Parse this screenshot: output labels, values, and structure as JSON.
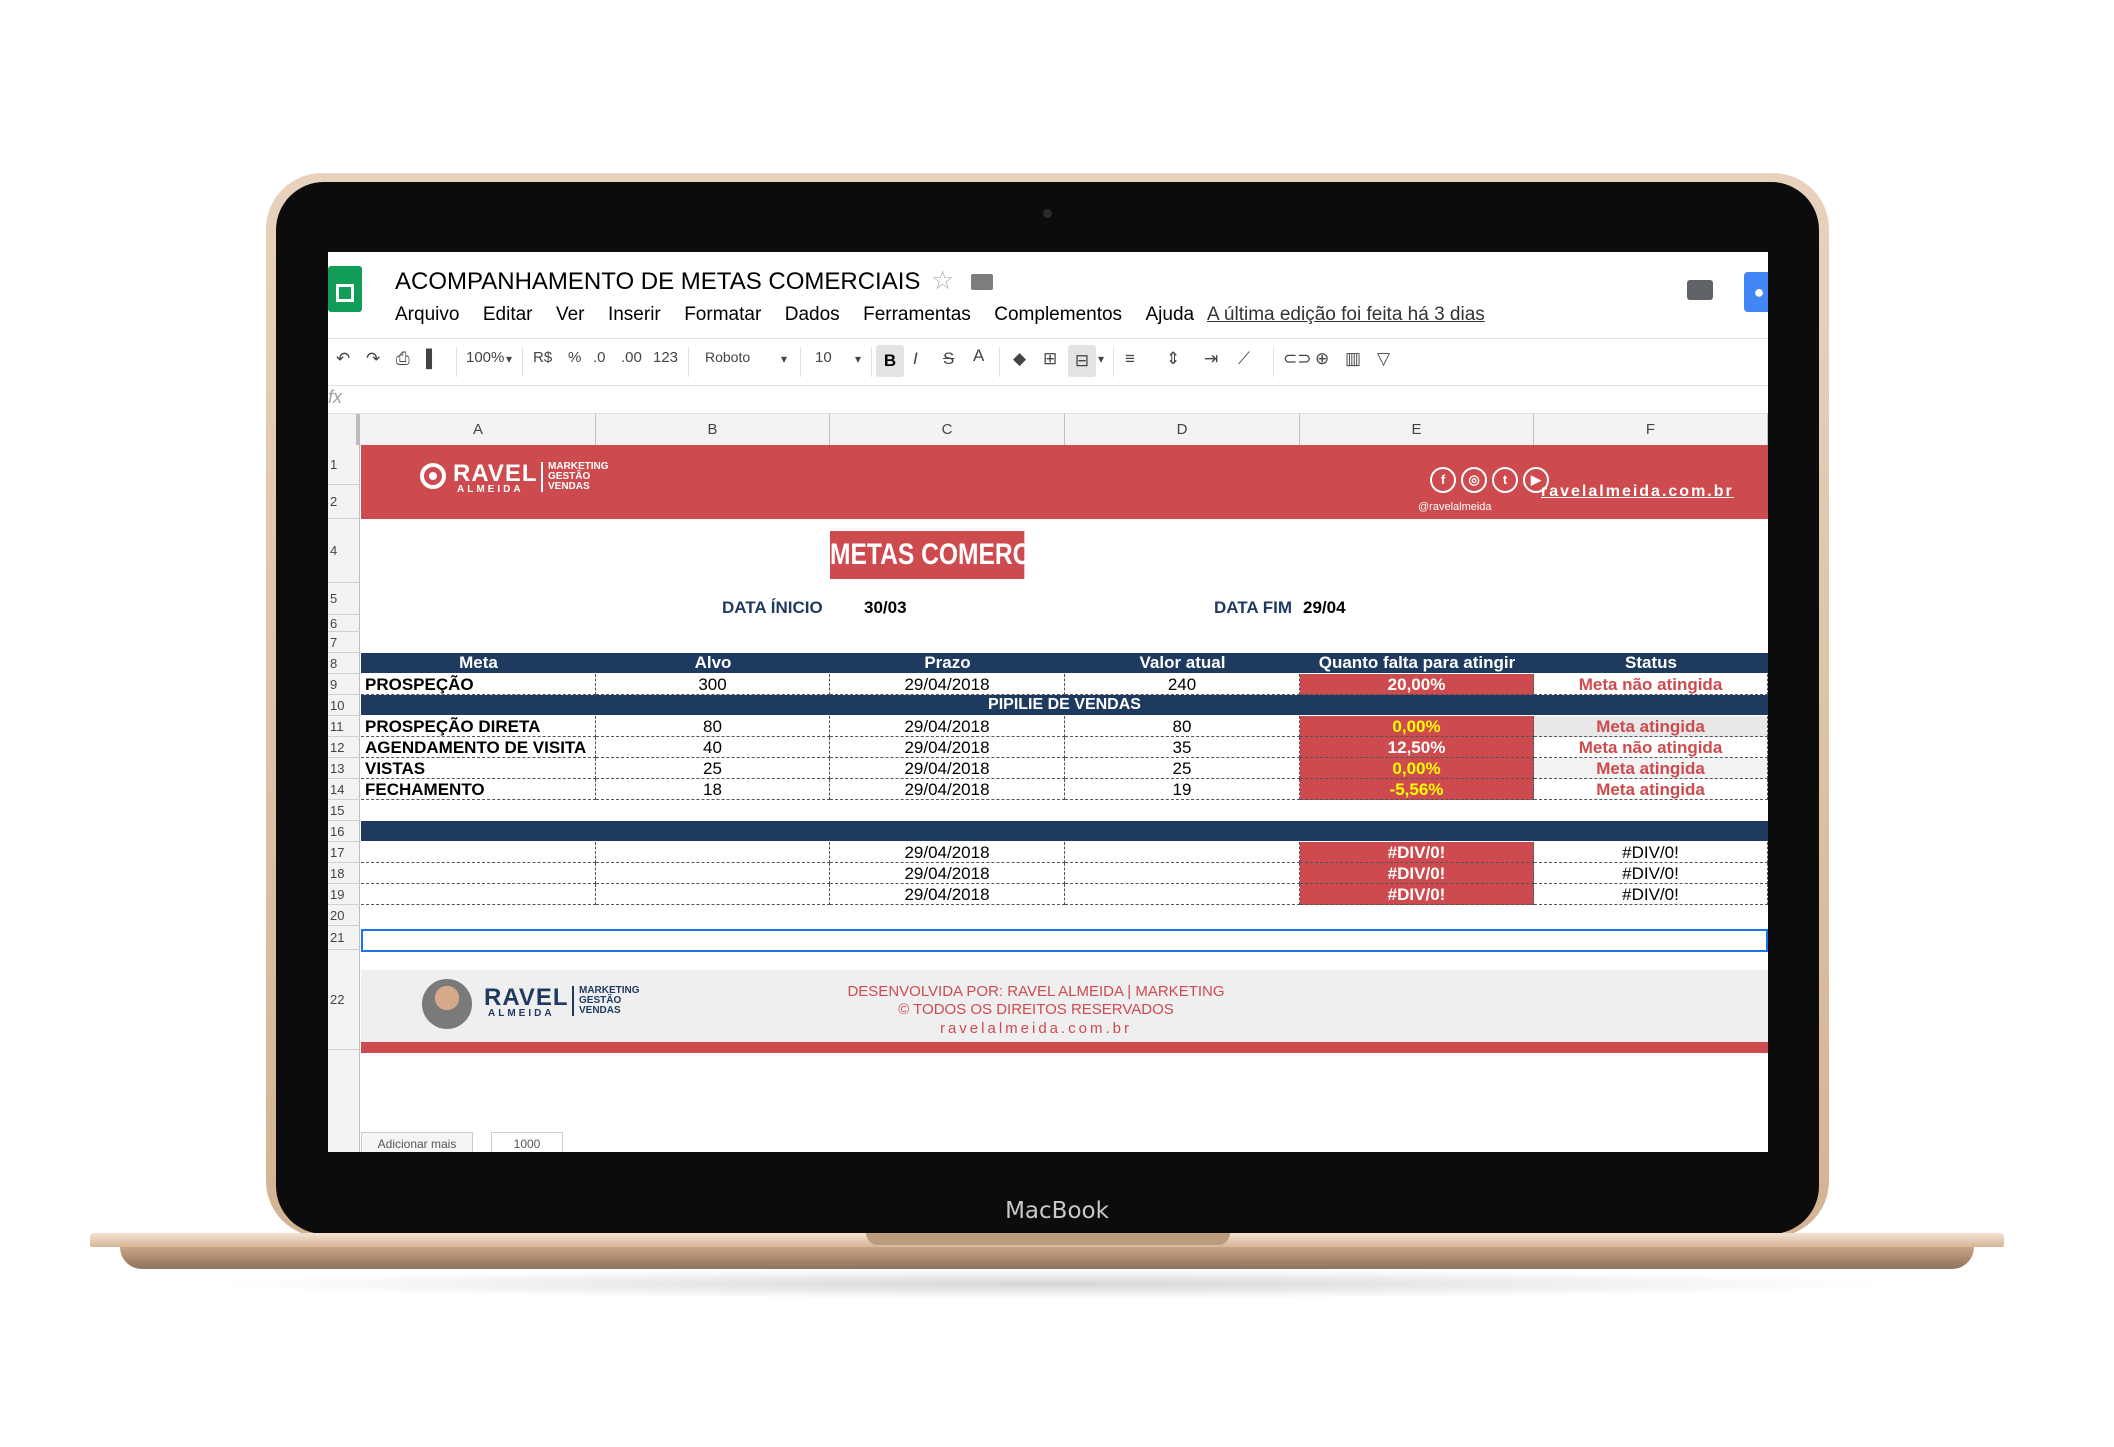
{
  "device": {
    "brand": "MacBook"
  },
  "app": {
    "title": "ACOMPANHAMENTO DE METAS COMERCIAIS",
    "menu": [
      "Arquivo",
      "Editar",
      "Ver",
      "Inserir",
      "Formatar",
      "Dados",
      "Ferramentas",
      "Complementos",
      "Ajuda"
    ],
    "last_edit": "A última edição foi feita há 3 dias"
  },
  "toolbar": {
    "zoom": "100%",
    "currency": "R$",
    "percent": "%",
    "decimal_less": ".0",
    "decimal_more": ".00",
    "more_formats": "123",
    "font": "Roboto",
    "font_size": "10",
    "bold": "B",
    "italic": "I",
    "strike": "S",
    "text_color": "A",
    "icons": [
      "undo-icon",
      "redo-icon",
      "print-icon",
      "paint-format-icon",
      "fill-color-icon",
      "borders-icon",
      "merge-cells-icon",
      "align-icon",
      "valign-icon",
      "wrap-icon",
      "rotate-icon",
      "link-icon",
      "comment-add-icon",
      "chart-icon",
      "filter-icon"
    ]
  },
  "formula_bar": {
    "fx": "fx"
  },
  "columns": [
    "A",
    "B",
    "C",
    "D",
    "E",
    "F"
  ],
  "rows": [
    "1",
    "2",
    "4",
    "5",
    "6",
    "7",
    "8",
    "9",
    "10",
    "11",
    "12",
    "13",
    "14",
    "15",
    "16",
    "17",
    "18",
    "19",
    "20",
    "21",
    "22"
  ],
  "banner": {
    "logo_name": "RAVEL",
    "logo_sub": "ALMEIDA",
    "logo_tag": [
      "MARKETING",
      "GESTÃO",
      "VENDAS"
    ],
    "social": [
      "f",
      "◎",
      "t",
      "▶"
    ],
    "handle": "@ravelalmeida",
    "site": "ravelalmeida.com.br"
  },
  "main_title": "METAS COMERCIAIS",
  "dates": {
    "start_label": "DATA ÍNICIO",
    "start_value": "30/03",
    "end_label": "DATA FIM",
    "end_value": "29/04"
  },
  "table": {
    "headers": [
      "Meta",
      "Alvo",
      "Prazo",
      "Valor atual",
      "Quanto falta para atingir",
      "Status"
    ],
    "top_row": {
      "meta": "PROSPEÇÃO",
      "alvo": "300",
      "prazo": "29/04/2018",
      "valor": "240",
      "falta": "20,00%",
      "status": "Meta não atingida"
    },
    "section_title": "PIPILIE DE VENDAS",
    "pipeline": [
      {
        "meta": "PROSPEÇÃO DIRETA",
        "alvo": "80",
        "prazo": "29/04/2018",
        "valor": "80",
        "falta": "0,00%",
        "status": "Meta atingida"
      },
      {
        "meta": "AGENDAMENTO DE VISITA",
        "alvo": "40",
        "prazo": "29/04/2018",
        "valor": "35",
        "falta": "12,50%",
        "status": "Meta não atingida"
      },
      {
        "meta": "VISTAS",
        "alvo": "25",
        "prazo": "29/04/2018",
        "valor": "25",
        "falta": "0,00%",
        "status": "Meta atingida"
      },
      {
        "meta": "FECHAMENTO",
        "alvo": "18",
        "prazo": "29/04/2018",
        "valor": "19",
        "falta": "-5,56%",
        "status": "Meta atingida"
      }
    ],
    "extra": [
      {
        "prazo": "29/04/2018",
        "falta": "#DIV/0!",
        "status": "#DIV/0!"
      },
      {
        "prazo": "29/04/2018",
        "falta": "#DIV/0!",
        "status": "#DIV/0!"
      },
      {
        "prazo": "29/04/2018",
        "falta": "#DIV/0!",
        "status": "#DIV/0!"
      }
    ]
  },
  "footer": {
    "logo_name": "RAVEL",
    "logo_sub": "ALMEIDA",
    "logo_tag": [
      "MARKETING",
      "GESTÃO",
      "VENDAS"
    ],
    "credit_line1": "DESENVOLVIDA POR:  RAVEL ALMEIDA | MARKETING",
    "credit_line2": "© TODOS OS DIREITOS RESERVADOS",
    "credit_line3": "ravelalmeida.com.br"
  },
  "bottom": {
    "add_label": "Adicionar mais",
    "rows_value": "1000"
  },
  "colors": {
    "red": "#cd4b4e",
    "navy": "#1e3a5f",
    "yellow": "#ffff00"
  }
}
